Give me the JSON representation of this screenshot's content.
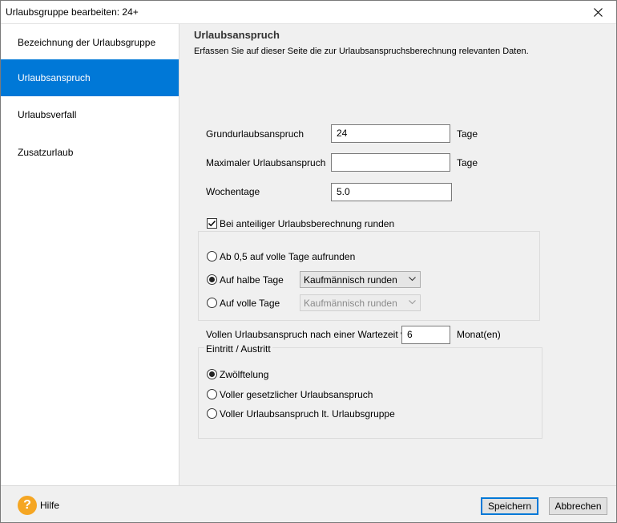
{
  "window": {
    "title": "Urlaubsgruppe bearbeiten: 24+",
    "close_icon": "close-icon"
  },
  "sidebar": {
    "items": [
      {
        "label": "Bezeichnung der Urlaubsgruppe",
        "active": false
      },
      {
        "label": "Urlaubsanspruch",
        "active": true
      },
      {
        "label": "Urlaubsverfall",
        "active": false
      },
      {
        "label": "Zusatzurlaub",
        "active": false
      }
    ],
    "accent_color": "#0078d7"
  },
  "main": {
    "heading": "Urlaubsanspruch",
    "subheading": "Erfassen Sie auf dieser Seite die zur Urlaubsanspruchsberechnung relevanten Daten.",
    "fields": {
      "grundurlaub": {
        "label": "Grundurlaubsanspruch",
        "value": "24",
        "unit": "Tage"
      },
      "maximal": {
        "label": "Maximaler Urlaubsanspruch",
        "value": "",
        "unit": "Tage"
      },
      "wochentage": {
        "label": "Wochentage",
        "value": "5.0"
      }
    },
    "rounding": {
      "checkbox_label": "Bei anteiliger Urlaubsberechnung runden",
      "checked": true,
      "options": [
        {
          "label": "Ab 0,5 auf volle Tage aufrunden",
          "checked": false
        },
        {
          "label": "Auf halbe Tage",
          "checked": true,
          "select_value": "Kaufmännisch runden"
        },
        {
          "label": "Auf volle Tage",
          "checked": false,
          "select_value": "Kaufmännisch runden"
        }
      ]
    },
    "wartezeit": {
      "label": "Vollen Urlaubsanspruch nach einer Wartezeit von",
      "value": "6",
      "unit": "Monat(en)"
    },
    "eintritt": {
      "group_label": "Eintritt / Austritt",
      "options": [
        {
          "label": "Zwölftelung",
          "checked": true
        },
        {
          "label": "Voller gesetzlicher Urlaubsanspruch",
          "checked": false
        },
        {
          "label": "Voller Urlaubsanspruch lt. Urlaubsgruppe",
          "checked": false
        }
      ]
    }
  },
  "footer": {
    "help_label": "Hilfe",
    "help_icon": "question-icon",
    "help_icon_color": "#f5a623",
    "save_label": "Speichern",
    "cancel_label": "Abbrechen"
  }
}
